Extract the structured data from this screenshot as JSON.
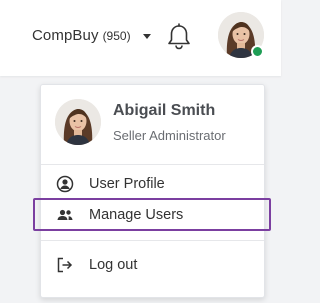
{
  "header": {
    "company_name": "CompBuy",
    "company_count": "(950)",
    "icons": {
      "caret": "caret-down-icon",
      "bell": "bell-icon"
    },
    "avatar_status_color": "#1f9d55"
  },
  "user_menu": {
    "name": "Abigail Smith",
    "role": "Seller Administrator",
    "items": [
      {
        "label": "User Profile",
        "icon": "user-circle-icon"
      },
      {
        "label": "Manage Users",
        "icon": "users-icon"
      },
      {
        "label": "Log out",
        "icon": "logout-icon"
      }
    ]
  },
  "colors": {
    "highlight_border": "#7b3fa0",
    "status_online": "#1f9d55"
  }
}
